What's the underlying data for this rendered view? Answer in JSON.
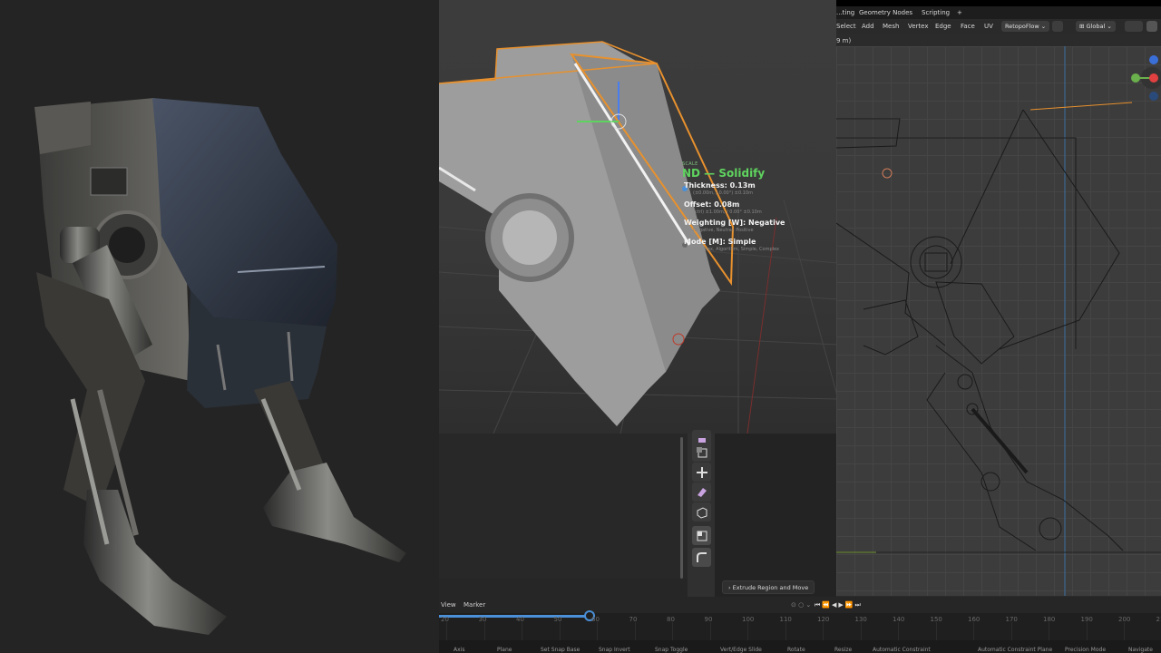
{
  "hud": {
    "tag": "SCALE",
    "title": "ND — Solidify",
    "thickness_label": "Thickness: 0.13m",
    "thickness_sub": "(±0.00m, / 0.00°) ±0.10m",
    "offset_label": "Offset: 0.08m",
    "offset_sub": "(ctrl) ±1.00m, / 0.00° ±0.10m",
    "weighting_label": "Weighting [W]: Negative",
    "weighting_sub": "Negative, Neutral, Positive",
    "mode_label": "Mode [M]: Simple",
    "mode_sub": "Complex, Algorithm, Simple, Complex"
  },
  "tabs": [
    "...ting",
    "Geometry Nodes",
    "Scripting",
    "+"
  ],
  "menu": {
    "items": [
      "Select",
      "Add",
      "Mesh",
      "Vertex",
      "Edge",
      "Face",
      "UV"
    ],
    "addon": "RetopoFlow",
    "transform": "Global"
  },
  "viewport_info": "9 m)",
  "tooltip": "Extrude Region and Move",
  "timeline": {
    "menu": [
      "View",
      "Marker"
    ],
    "ticks": [
      "20",
      "30",
      "40",
      "50",
      "60",
      "70",
      "80",
      "90",
      "100",
      "110",
      "120",
      "130",
      "140",
      "150",
      "160",
      "170",
      "180",
      "190",
      "200",
      "210"
    ],
    "playhead_frame": 58
  },
  "statusbar": [
    "Axis",
    "Plane",
    "Set Snap Base",
    "Snap Invert",
    "Snap Toggle",
    "Vert/Edge Slide",
    "Rotate",
    "Resize",
    "Automatic Constraint",
    "Automatic Constraint Plane",
    "Precision Mode",
    "Navigate"
  ],
  "colors": {
    "accent_green": "#5fd35f",
    "selection_orange": "#e8912e",
    "timeline_blue": "#4a8fd8"
  }
}
